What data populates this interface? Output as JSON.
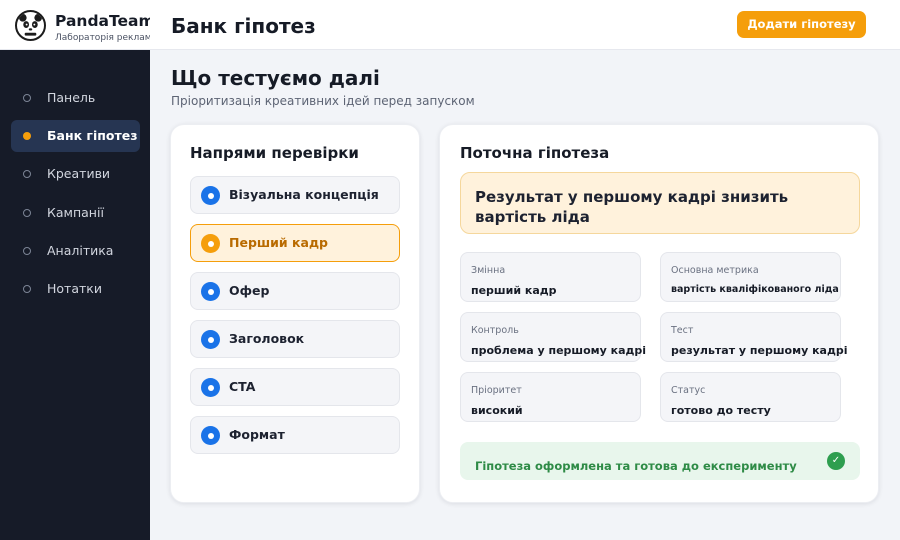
{
  "brand": {
    "name": "PandaTeam",
    "subtitle": "Лабораторія реклами"
  },
  "sidebar": {
    "items": [
      {
        "label": "Панель",
        "active": false
      },
      {
        "label": "Банк гіпотез",
        "active": true
      },
      {
        "label": "Креативи",
        "active": false
      },
      {
        "label": "Кампанії",
        "active": false
      },
      {
        "label": "Аналітика",
        "active": false
      },
      {
        "label": "Нотатки",
        "active": false
      }
    ]
  },
  "header": {
    "title": "Банк гіпотез",
    "add_button": "Додати гіпотезу"
  },
  "page": {
    "title": "Що тестуємо далі",
    "subtitle": "Пріоритизація креативних ідей перед запуском"
  },
  "directions": {
    "title": "Напрями перевірки",
    "items": [
      {
        "label": "Візуальна концепція",
        "active": false
      },
      {
        "label": "Перший кадр",
        "active": true
      },
      {
        "label": "Офер",
        "active": false
      },
      {
        "label": "Заголовок",
        "active": false
      },
      {
        "label": "CTA",
        "active": false
      },
      {
        "label": "Формат",
        "active": false
      }
    ]
  },
  "current": {
    "title": "Поточна гіпотеза",
    "hypothesis": "Результат у першому кадрі знизить вартість ліда",
    "fields": [
      {
        "label": "Змінна",
        "value": "перший кадр"
      },
      {
        "label": "Основна метрика",
        "value": "вартість кваліфікованого ліда"
      },
      {
        "label": "Контроль",
        "value": "проблема у першому кадрі"
      },
      {
        "label": "Тест",
        "value": "результат у першому кадрі"
      },
      {
        "label": "Пріоритет",
        "value": "високий"
      },
      {
        "label": "Статус",
        "value": "готово до тесту"
      }
    ],
    "status_message": "Гіпотеза оформлена та готова до експерименту",
    "status_icon": "✓"
  },
  "colors": {
    "accent": "#f59e0b",
    "sidebar_bg": "#161b28",
    "primary_blue": "#1a73e8",
    "success": "#2e9e4f"
  }
}
